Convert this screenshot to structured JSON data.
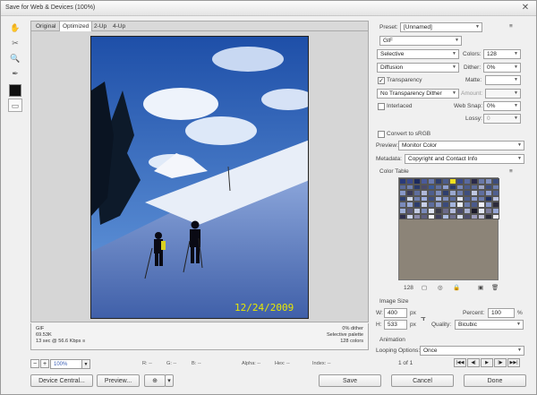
{
  "window": {
    "title": "Save for Web & Devices (100%)",
    "close_glyph": "✕"
  },
  "tabs": [
    "Original",
    "Optimized",
    "2-Up",
    "4-Up"
  ],
  "image": {
    "date_stamp": "12/24/2009"
  },
  "info_left": [
    "GIF",
    "69.53K",
    "13 sec @ 56.6 Kbps"
  ],
  "info_left_icon": "≡",
  "info_right": [
    "0% dither",
    "Selective palette",
    "128 colors"
  ],
  "zoom": {
    "value": "100%",
    "minus": "−",
    "plus": "+"
  },
  "readouts": {
    "r": "R: --",
    "g": "G: --",
    "b": "B: --",
    "alpha": "Alpha: --",
    "hex": "Hex: --",
    "index": "Index: --"
  },
  "bottom_buttons": {
    "device_central": "Device Central...",
    "preview": "Preview...",
    "save": "Save",
    "cancel": "Cancel",
    "done": "Done"
  },
  "settings": {
    "preset_label": "Preset:",
    "preset_value": "[Unnamed]",
    "format": "GIF",
    "reduction": "Selective",
    "dither_algo": "Diffusion",
    "transparency_label": "Transparency",
    "transparency_checked": true,
    "transparency_dither": "No Transparency Dither",
    "interlaced_label": "Interlaced",
    "colors_label": "Colors:",
    "colors_value": "128",
    "dither_label": "Dither:",
    "dither_value": "0%",
    "matte_label": "Matte:",
    "amount_label": "Amount:",
    "websnap_label": "Web Snap:",
    "websnap_value": "0%",
    "lossy_label": "Lossy:",
    "lossy_value": "0",
    "srgb_label": "Convert to sRGB",
    "preview_label": "Preview:",
    "preview_value": "Monitor Color",
    "metadata_label": "Metadata:",
    "metadata_value": "Copyright and Contact Info"
  },
  "color_table": {
    "title": "Color Table",
    "count": "128",
    "colors": [
      "#2a3a7a",
      "#3b4a8c",
      "#1c2a5e",
      "#4a5a9a",
      "#6a7ab0",
      "#2c3c6c",
      "#4c5c8c",
      "#f0e020",
      "#3a4a8a",
      "#5a6aa0",
      "#2a2a4a",
      "#6878a8",
      "#8090c0",
      "#3c4c7c",
      "#5a6a9a",
      "#7080b0",
      "#2a3a6a",
      "#4a4a6a",
      "#3a5a9a",
      "#6070a0",
      "#90a0d0",
      "#2b3b6b",
      "#7888b8",
      "#4b5b8b",
      "#5c6c9c",
      "#a0a8c8",
      "#3d4d7d",
      "#6d7dad",
      "#8898c8",
      "#3a3a5a",
      "#5e6e9e",
      "#b0b8d8",
      "#4e5e8e",
      "#7e8ebe",
      "#2e3e6e",
      "#9aa8d0",
      "#6e7eae",
      "#3e4e7e",
      "#c0c8e0",
      "#5f6f9f",
      "#8f9fcf",
      "#4f5f8f",
      "#2f3f6f",
      "#d0d8e8",
      "#6f7faf",
      "#9fafdf",
      "#3f4f7f",
      "#a8b8e0",
      "#7f8fbf",
      "#5b6b9b",
      "#e0e4f0",
      "#4d5d8d",
      "#8d9dcd",
      "#6b7bab",
      "#1f2f5f",
      "#b8c0e0",
      "#7b8bbb",
      "#9babd8",
      "#2d3d6d",
      "#c8d0e8",
      "#5d6d9d",
      "#8a9aca",
      "#3b4b7b",
      "#a4b4dc",
      "#e8ecf4",
      "#6c7cac",
      "#4a5a8a",
      "#f0f0f8",
      "#8b9bcb",
      "#2c2c3c",
      "#9eaed6",
      "#5a5a7a",
      "#c4cce4",
      "#7a8aba",
      "#dde2f0",
      "#3a3a4a",
      "#6a6a8a",
      "#b4bcdc",
      "#4c4c6c",
      "#a8b0d0",
      "#1a1a2a",
      "#e4e8f4",
      "#7c7c9c",
      "#96a6d6",
      "#2e2e4e",
      "#ccd4ec",
      "#8c8cac",
      "#5e5e7e",
      "#f4f4fa",
      "#3e3e5e",
      "#aebee2",
      "#6e6e8e",
      "#d6dcee",
      "#4e4e6e",
      "#9c9cbc",
      "#c0c0d8",
      "#2a2a3a",
      "#ececf6"
    ]
  },
  "image_size": {
    "title": "Image Size",
    "w_label": "W:",
    "w_value": "400",
    "h_label": "H:",
    "h_value": "533",
    "px": "px",
    "percent_label": "Percent:",
    "percent_value": "100",
    "percent_unit": "%",
    "quality_label": "Quality:",
    "quality_value": "Bicubic"
  },
  "animation": {
    "title": "Animation",
    "looping_label": "Looping Options:",
    "looping_value": "Once",
    "frame": "1 of 1",
    "controls": [
      "|◀◀",
      "◀|",
      "▶",
      "|▶",
      "▶▶|"
    ]
  }
}
